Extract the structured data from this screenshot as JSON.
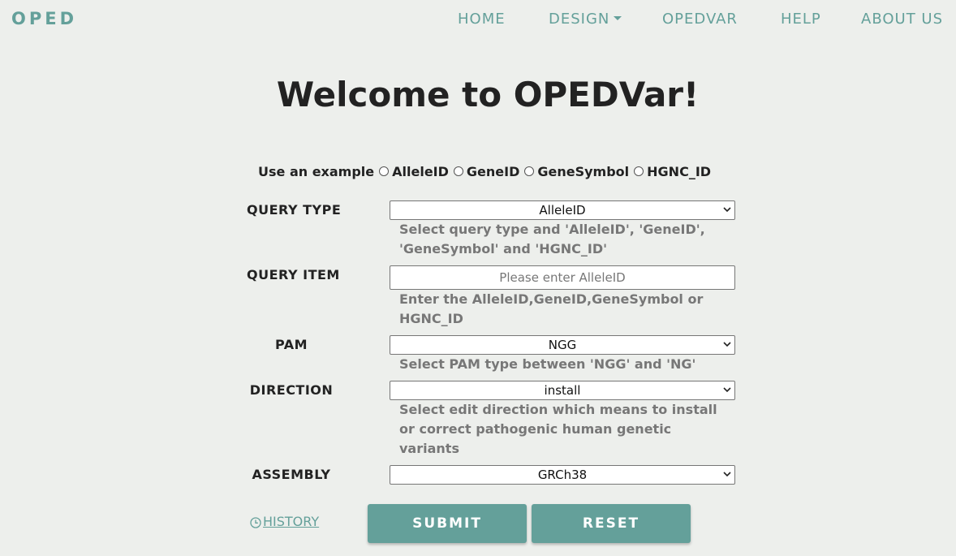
{
  "nav": {
    "brand": "OPED",
    "items": [
      "HOME",
      "DESIGN",
      "OPEDVAR",
      "HELP",
      "ABOUT US"
    ]
  },
  "page": {
    "title": "Welcome to OPEDVar!"
  },
  "example": {
    "label": "Use an example",
    "options": [
      "AlleleID",
      "GeneID",
      "GeneSymbol",
      "HGNC_ID"
    ]
  },
  "form": {
    "query_type": {
      "label": "QUERY TYPE",
      "value": "AlleleID",
      "help": "Select query type and 'AlleleID', 'GeneID', 'GeneSymbol' and 'HGNC_ID'"
    },
    "query_item": {
      "label": "QUERY ITEM",
      "placeholder": "Please enter AlleleID",
      "help": "Enter the AlleleID,GeneID,GeneSymbol or HGNC_ID"
    },
    "pam": {
      "label": "PAM",
      "value": "NGG",
      "help": "Select PAM type between 'NGG' and 'NG'"
    },
    "direction": {
      "label": "DIRECTION",
      "value": "install",
      "help": "Select edit direction which means to install or correct pathogenic human genetic variants"
    },
    "assembly": {
      "label": "ASSEMBLY",
      "value": "GRCh38"
    }
  },
  "actions": {
    "history": "HISTORY",
    "submit": "SUBMIT",
    "reset": "RESET"
  },
  "colors": {
    "accent": "#64a09a",
    "background": "#edefec",
    "help_text": "#777777"
  }
}
